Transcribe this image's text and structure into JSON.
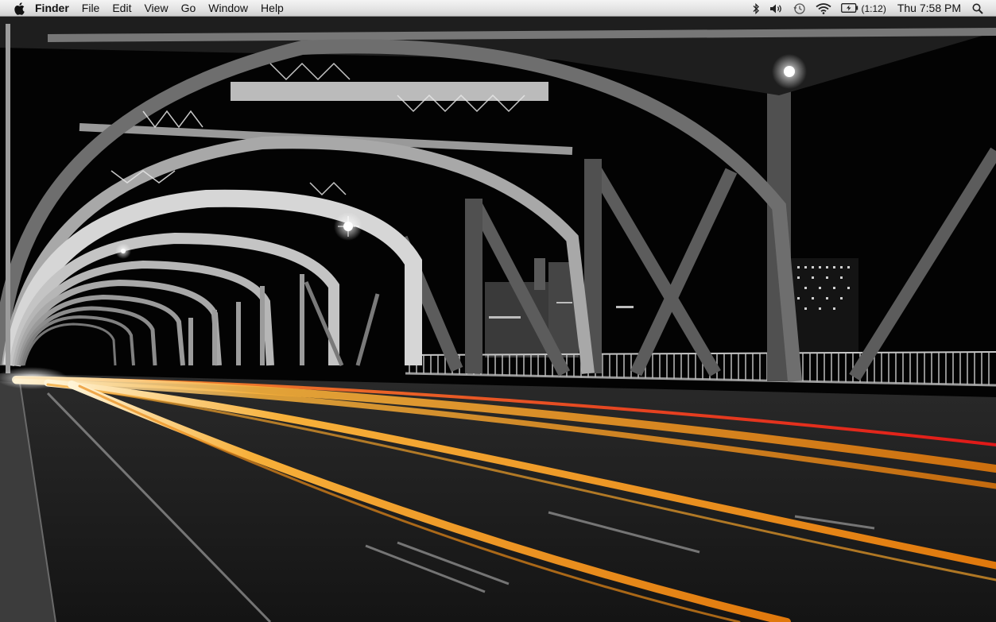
{
  "menubar": {
    "apple_icon": "apple-icon",
    "app_name": "Finder",
    "menus": [
      "File",
      "Edit",
      "View",
      "Go",
      "Window",
      "Help"
    ],
    "status": {
      "bluetooth_icon": "bluetooth-icon",
      "volume_icon": "volume-icon",
      "time_machine_icon": "time-machine-icon",
      "wifi_icon": "wifi-icon",
      "battery_icon": "battery-charging-icon",
      "battery_time": "(1:12)",
      "clock": "Thu 7:58 PM",
      "spotlight_icon": "spotlight-search-icon"
    }
  },
  "desktop": {
    "wallpaper": "night-steel-bridge-light-trails",
    "colors": {
      "light_trail_orange": "#f5a01e",
      "light_trail_red": "#e02020",
      "steel_gray": "#9a9a9a",
      "sky": "#000000"
    }
  }
}
